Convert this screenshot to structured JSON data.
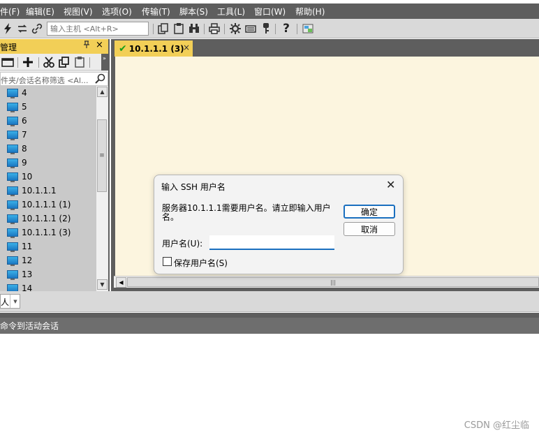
{
  "menu": [
    "件(F)",
    "编辑(E)",
    "视图(V)",
    "选项(O)",
    "传输(T)",
    "脚本(S)",
    "工具(L)",
    "窗口(W)",
    "帮助(H)"
  ],
  "toolbar": {
    "host_placeholder": "输入主机 <Alt+R>",
    "icons": [
      "lightning-icon",
      "reconnect-icon",
      "link-icon",
      "copy-icon",
      "paste-icon",
      "find-icon",
      "print-icon",
      "settings-icon",
      "keymap-icon",
      "key-icon",
      "help-icon",
      "sftp-icon"
    ]
  },
  "session_manager": {
    "title": "管理",
    "pin": "ㅁ",
    "close": "×",
    "filter_placeholder": "件夹/会话名称筛选 <Al...",
    "items": [
      "4",
      "5",
      "6",
      "7",
      "8",
      "9",
      "10",
      "10.1.1.1",
      "10.1.1.1 (1)",
      "10.1.1.1 (2)",
      "10.1.1.1 (3)",
      "11",
      "12",
      "13",
      "14"
    ]
  },
  "tabs": [
    {
      "label": "10.1.1.1 (3)",
      "close": "×",
      "status": "connected"
    }
  ],
  "command_bar": {
    "combo_value": "人",
    "send_label": "命令到活动会话"
  },
  "dialog": {
    "title": "输入 SSH 用户名",
    "close": "✕",
    "message": "服务器10.1.1.1需要用户名。请立即输入用户名。",
    "ok_label": "确定",
    "cancel_label": "取消",
    "username_label": "用户名(U):",
    "username_value": "",
    "save_label": "保存用户名(S)",
    "save_checked": false
  },
  "watermark": "CSDN @红尘临",
  "colors": {
    "accent_tab": "#f2cf57",
    "terminal_bg": "#fcf5df",
    "frame": "#5e5e5e",
    "focus": "#1a6fbf"
  }
}
